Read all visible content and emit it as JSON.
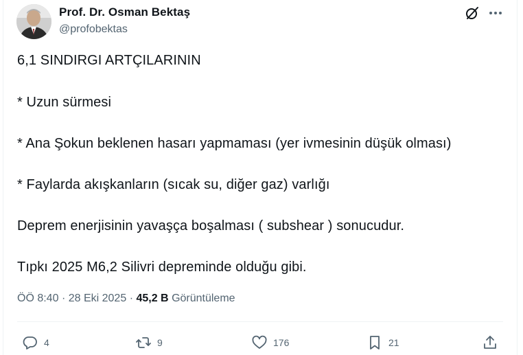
{
  "author": {
    "name": "Prof. Dr. Osman Bektaş",
    "handle": "@profobektas"
  },
  "tweet": {
    "lines": [
      "6,1 SINDIRGI ARTÇILARININ",
      "* Uzun sürmesi",
      "* Ana Şokun beklenen hasarı yapmaması (yer  ivmesinin düşük olması)",
      "* Faylarda akışkanların (sıcak su, diğer gaz) varlığı",
      "Deprem enerjisinin yavaşça boşalması ( subshear ) sonucudur.",
      "Tıpkı 2025 M6,2 Silivri depreminde olduğu gibi."
    ]
  },
  "meta": {
    "time": "ÖÖ 8:40",
    "separator": "·",
    "date": "28 Eki 2025",
    "views_count": "45,2 B",
    "views_label": "Görüntüleme"
  },
  "actions": {
    "replies": "4",
    "reposts": "9",
    "likes": "176",
    "bookmarks": "21"
  },
  "icons": {
    "grok": "grok-icon",
    "more": "more-icon",
    "reply": "reply-icon",
    "retweet": "retweet-icon",
    "like": "heart-icon",
    "bookmark": "bookmark-icon",
    "share": "share-icon"
  },
  "colors": {
    "text": "#0f1419",
    "secondary": "#536471",
    "divider": "#eff3f4"
  }
}
